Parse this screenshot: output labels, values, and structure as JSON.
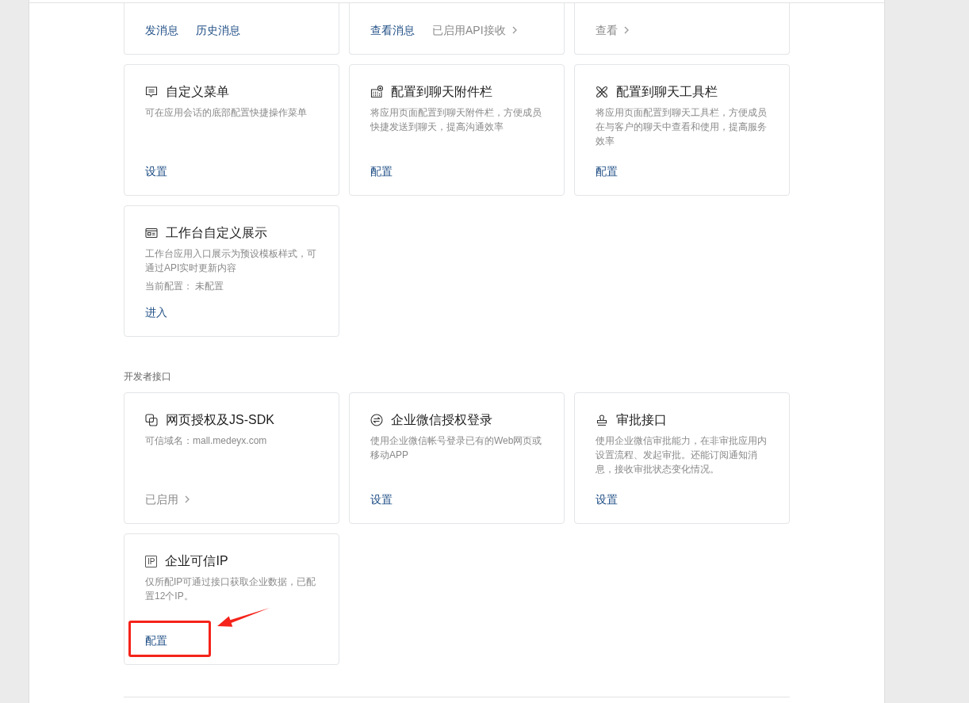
{
  "sections": [
    {
      "cards": [
        {
          "actions": [
            {
              "kind": "link",
              "label": "发消息"
            },
            {
              "kind": "link",
              "label": "历史消息"
            }
          ],
          "annotated": false
        },
        {
          "actions": [
            {
              "kind": "link",
              "label": "查看消息"
            },
            {
              "kind": "status",
              "label": "已启用API接收"
            }
          ],
          "annotated": false
        },
        {
          "actions": [
            {
              "kind": "status",
              "label": "查看"
            }
          ],
          "annotated": false
        },
        {
          "title": "自定义菜单",
          "description": "可在应用会话的底部配置快捷操作菜单",
          "actions": [
            {
              "kind": "link",
              "label": "设置"
            }
          ],
          "annotated": false
        },
        {
          "title": "配置到聊天附件栏",
          "description": "将应用页面配置到聊天附件栏，方便成员快捷发送到聊天，提高沟通效率",
          "actions": [
            {
              "kind": "link",
              "label": "配置"
            }
          ],
          "annotated": false
        },
        {
          "title": "配置到聊天工具栏",
          "description": "将应用页面配置到聊天工具栏，方便成员在与客户的聊天中查看和使用，提高服务效率",
          "actions": [
            {
              "kind": "link",
              "label": "配置"
            }
          ],
          "annotated": false
        },
        {
          "title": "工作台自定义展示",
          "description": "工作台应用入口展示为预设模板样式，可通过API实时更新内容",
          "note": "当前配置： 未配置",
          "actions": [
            {
              "kind": "link",
              "label": "进入"
            }
          ],
          "annotated": false
        }
      ]
    },
    {
      "title": "开发者接口",
      "cards": [
        {
          "title": "网页授权及JS-SDK",
          "description": "可信域名：mall.medeyx.com",
          "actions": [
            {
              "kind": "status",
              "label": "已启用"
            }
          ],
          "annotated": false
        },
        {
          "title": "企业微信授权登录",
          "description": "使用企业微信帐号登录已有的Web网页或移动APP",
          "actions": [
            {
              "kind": "link",
              "label": "设置"
            }
          ],
          "annotated": false
        },
        {
          "title": "审批接口",
          "description": "使用企业微信审批能力，在非审批应用内设置流程、发起审批。还能订阅通知消息，接收审批状态变化情况。",
          "actions": [
            {
              "kind": "link",
              "label": "设置"
            }
          ],
          "annotated": false
        },
        {
          "title": "企业可信IP",
          "icon_text": "IP",
          "description": "仅所配IP可通过接口获取企业数据，已配置12个IP。",
          "actions": [
            {
              "kind": "link",
              "label": "配置"
            }
          ],
          "annotated": true
        }
      ]
    }
  ]
}
